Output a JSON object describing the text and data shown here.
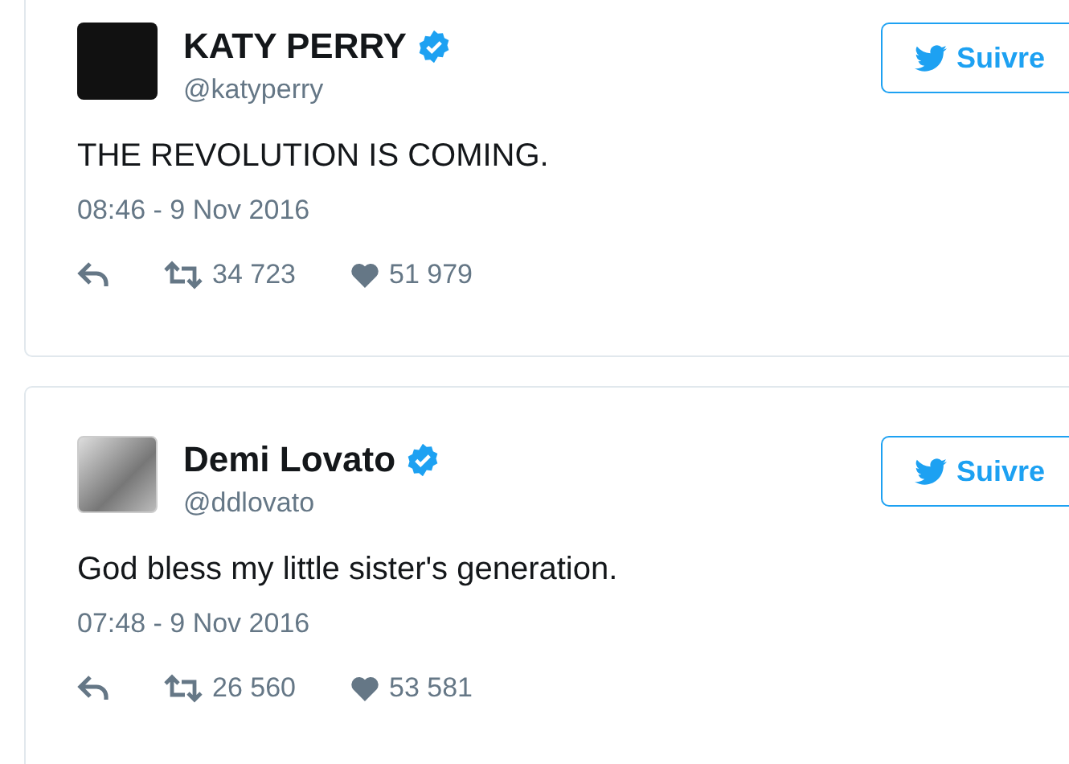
{
  "tweets": [
    {
      "avatar": {
        "kind": "dark"
      },
      "name": "KATY PERRY",
      "verified": true,
      "handle": "@katyperry",
      "follow_label": "Suivre",
      "text": "THE REVOLUTION IS COMING.",
      "timestamp": "08:46 - 9 Nov 2016",
      "retweets": "34 723",
      "likes": "51 979"
    },
    {
      "avatar": {
        "kind": "photo"
      },
      "name": "Demi Lovato",
      "verified": true,
      "handle": "@ddlovato",
      "follow_label": "Suivre",
      "text": "God bless my little sister's generation.",
      "timestamp": "07:48 - 9 Nov 2016",
      "retweets": "26 560",
      "likes": "53 581"
    }
  ]
}
